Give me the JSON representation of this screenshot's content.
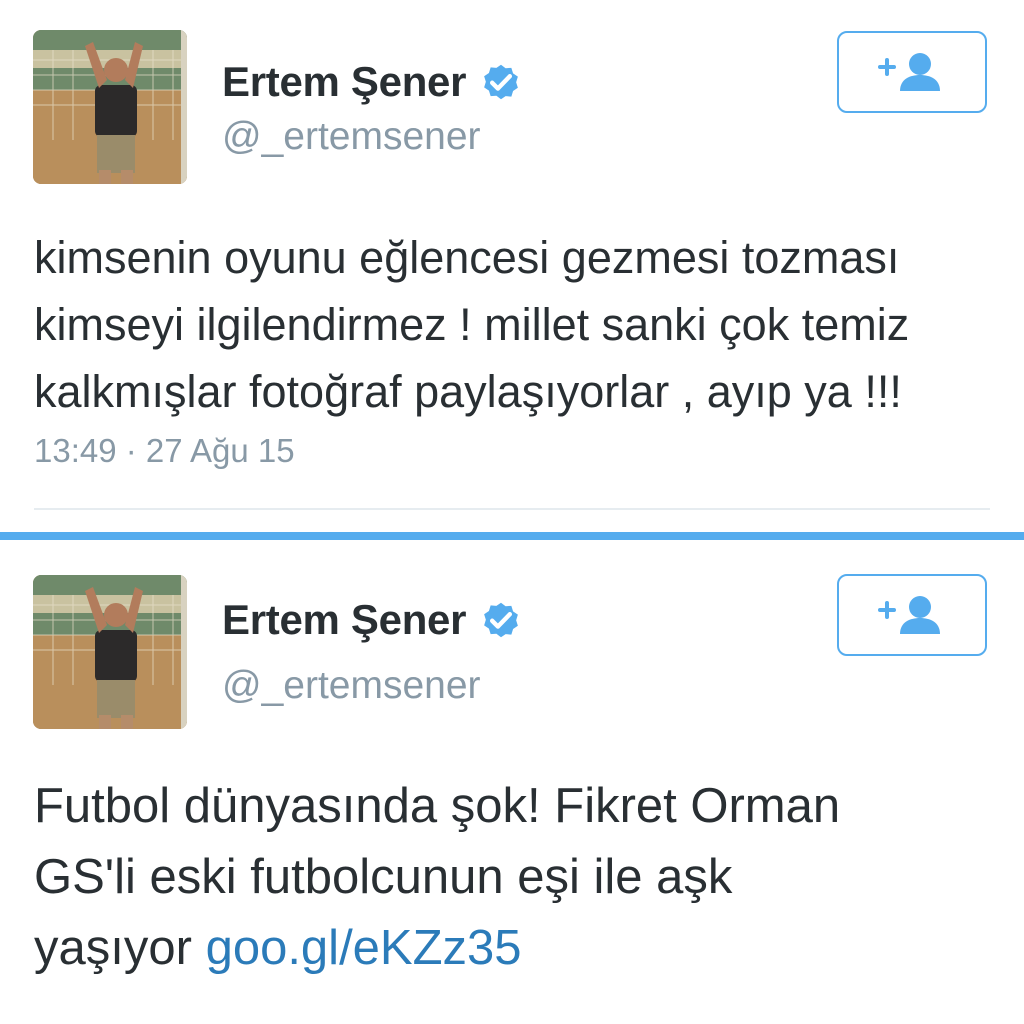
{
  "colors": {
    "accent": "#55acee",
    "link": "#2b7bb9",
    "text": "#292f33",
    "muted": "#8899a6",
    "divider": "#e6ecf0"
  },
  "tweets": [
    {
      "author": {
        "name": "Ertem Şener",
        "handle": "@_ertemsener",
        "verified": true,
        "avatar_icon": "profile-photo"
      },
      "follow_icon": "add-user-icon",
      "text_lines": [
        "kimsenin oyunu eğlencesi gezmesi tozması",
        "kimseyi ilgilendirmez ! millet sanki çok temiz",
        "kalkmışlar fotoğraf paylaşıyorlar , ayıp ya !!!"
      ],
      "timestamp": "13:49 · 27 Ağu 15"
    },
    {
      "author": {
        "name": "Ertem Şener",
        "handle": "@_ertemsener",
        "verified": true,
        "avatar_icon": "profile-photo"
      },
      "follow_icon": "add-user-icon",
      "text_lines": [
        "Futbol dünyasında şok! Fikret Orman",
        "GS'li eski futbolcunun eşi ile aşk",
        "yaşıyor"
      ],
      "link": "goo.gl/eKZz35"
    }
  ]
}
